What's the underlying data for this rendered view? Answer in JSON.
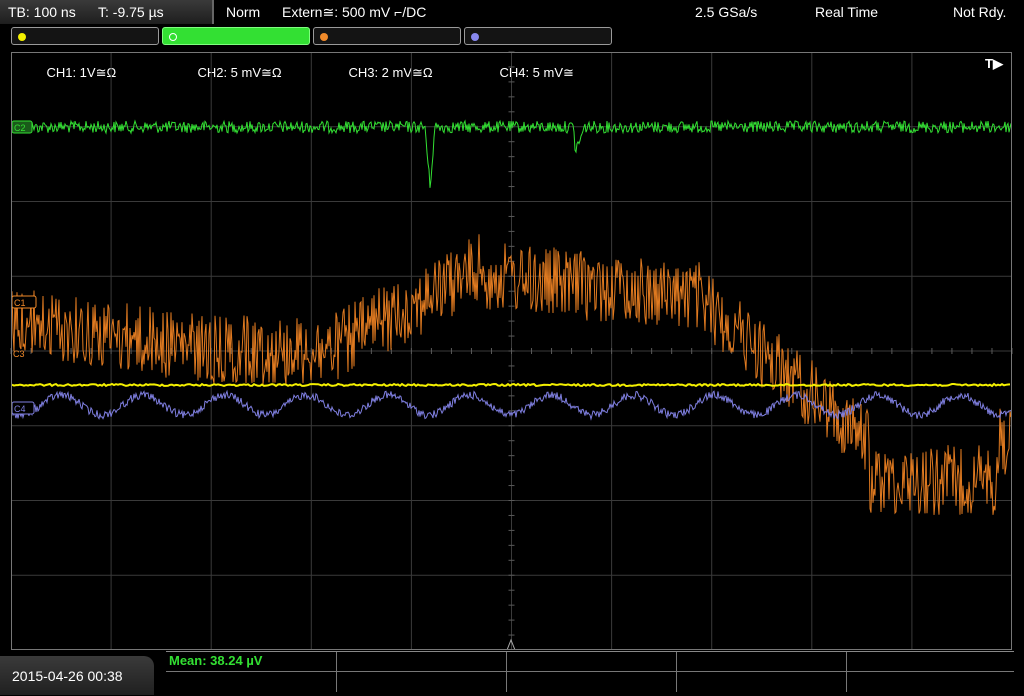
{
  "status": {
    "timebase": "TB: 100 ns",
    "trigger_time": "T: -9.75 µs",
    "mode": "Norm",
    "trigger_source": "Extern≅: 500 mV ⌐/DC",
    "sample_rate": "2.5 GSa/s",
    "acq_mode": "Real Time",
    "state": "Not Rdy."
  },
  "channels": [
    {
      "label": "CH1: 1V≅Ω",
      "color": "#f4f000"
    },
    {
      "label": "CH2: 5 mV≅Ω",
      "color": "#33e033"
    },
    {
      "label": "CH3: 2 mV≅Ω",
      "color": "#f08a2a"
    },
    {
      "label": "CH4: 5 mV≅",
      "color": "#8888ee"
    }
  ],
  "markers": {
    "c1": "C1",
    "c2": "C2",
    "c3": "C3",
    "c4": "C4",
    "trigger_icon": "T▶"
  },
  "measurement": {
    "mean": "Mean: 38.24 µV"
  },
  "datetime": "2015-04-26 00:38",
  "colors": {
    "ch1": "#f4f000",
    "ch2": "#33e033",
    "ch3": "#e07a20",
    "ch4": "#7f7fe0",
    "grid": "#3a3a3a"
  }
}
